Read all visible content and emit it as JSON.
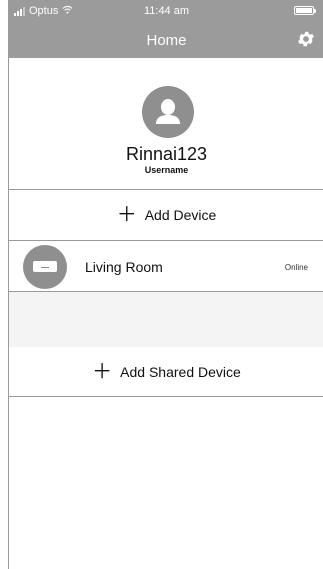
{
  "status_bar": {
    "carrier": "Optus",
    "time": "11:44 am"
  },
  "header": {
    "title": "Home"
  },
  "profile": {
    "username": "Rinnai123",
    "caption": "Username"
  },
  "actions": {
    "add_device": "Add Device",
    "add_shared_device": "Add Shared Device"
  },
  "devices": [
    {
      "name": "Living Room",
      "status": "Online"
    }
  ],
  "icons": {
    "signal": "signal-bars-icon",
    "wifi": "wifi-icon",
    "battery": "battery-icon",
    "settings": "gear-icon",
    "avatar": "user-icon",
    "device": "air-conditioner-icon",
    "add": "plus-icon"
  },
  "colors": {
    "header_bg": "#9b9b9b",
    "avatar_bg": "#8f8f8f",
    "divider": "#9a9a9a"
  }
}
